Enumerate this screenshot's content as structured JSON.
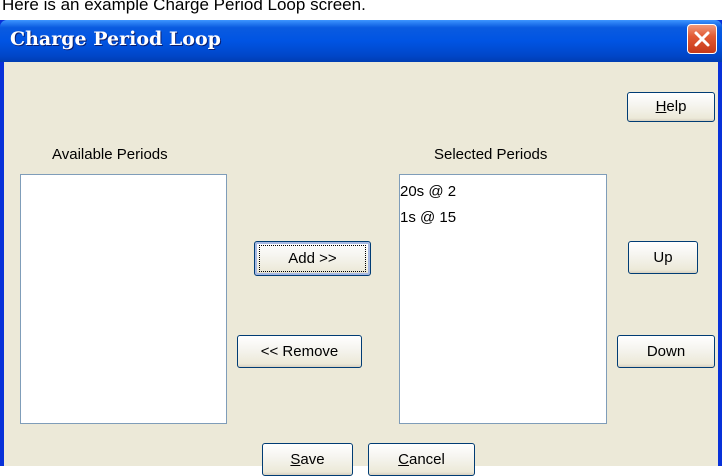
{
  "caption": "Here is an example Charge Period Loop screen.",
  "window": {
    "title": "Charge Period Loop",
    "close_icon": "close-icon"
  },
  "buttons": {
    "help": {
      "pre": "",
      "mnemonic": "H",
      "post": "elp"
    },
    "add": "Add >>",
    "remove": "<< Remove",
    "up": "Up",
    "down": "Down",
    "save": {
      "pre": "",
      "mnemonic": "S",
      "post": "ave"
    },
    "cancel": {
      "pre": "",
      "mnemonic": "C",
      "post": "ancel"
    }
  },
  "available": {
    "label": "Available Periods",
    "items": []
  },
  "selected": {
    "label": "Selected Periods",
    "items": [
      "20s @ 2",
      "1s @ 15"
    ]
  }
}
